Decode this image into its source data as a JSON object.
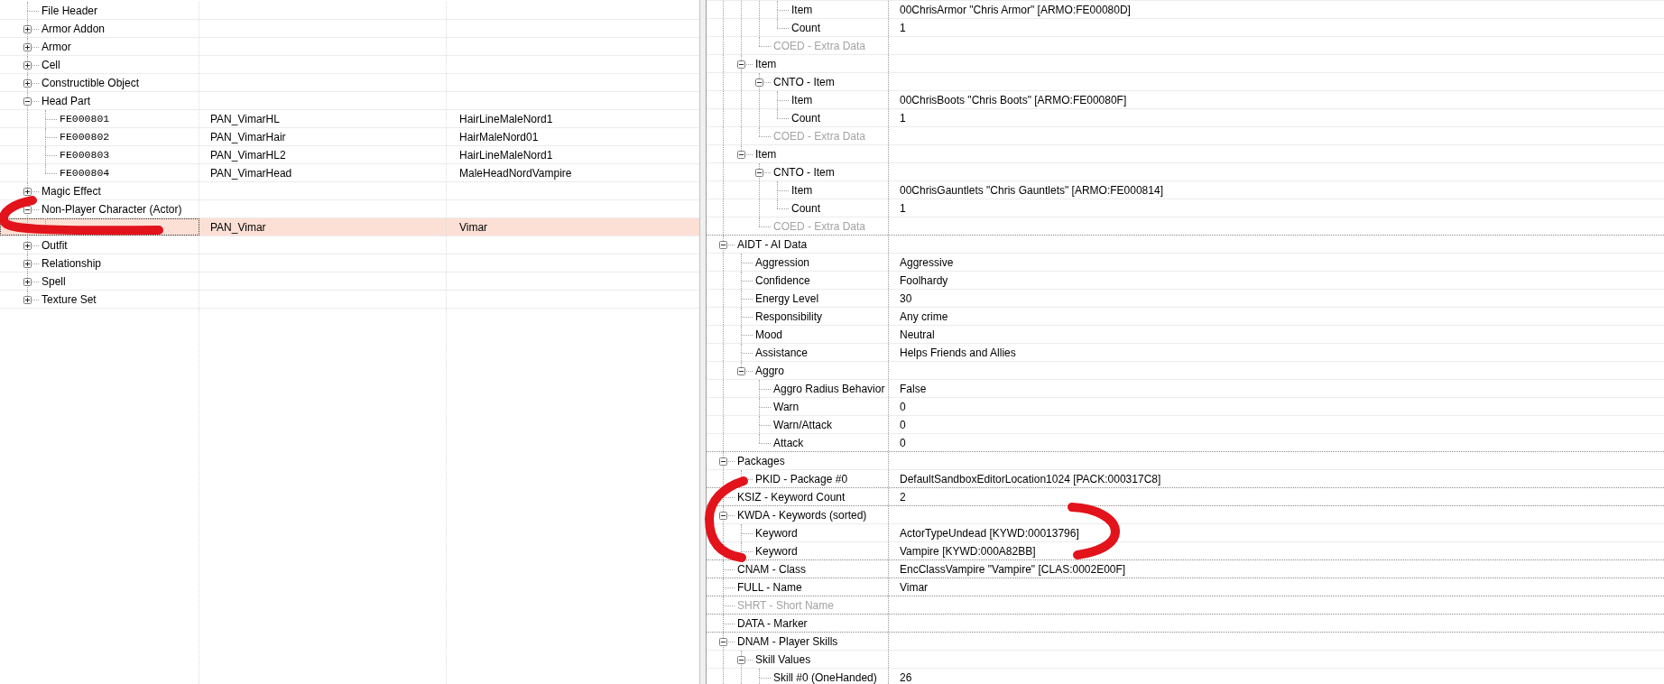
{
  "record_list": {
    "items": [
      {
        "kind": "header",
        "label": "File Header",
        "selected": false
      },
      {
        "kind": "group",
        "label": "Armor Addon",
        "expanded": false,
        "selected": false
      },
      {
        "kind": "group",
        "label": "Armor",
        "expanded": false,
        "selected": false
      },
      {
        "kind": "group",
        "label": "Cell",
        "expanded": false,
        "selected": false
      },
      {
        "kind": "group",
        "label": "Constructible Object",
        "expanded": false,
        "selected": false
      },
      {
        "kind": "group",
        "label": "Head Part",
        "expanded": true,
        "selected": false,
        "children": [
          {
            "kind": "record",
            "form_id": "FE000801",
            "editor_id": "PAN_VimarHL",
            "name": "HairLineMaleNord1",
            "selected": false
          },
          {
            "kind": "record",
            "form_id": "FE000802",
            "editor_id": "PAN_VimarHair",
            "name": "HairMaleNord01",
            "selected": false
          },
          {
            "kind": "record",
            "form_id": "FE000803",
            "editor_id": "PAN_VimarHL2",
            "name": "HairLineMaleNord1",
            "selected": false
          },
          {
            "kind": "record",
            "form_id": "FE000804",
            "editor_id": "PAN_VimarHead",
            "name": "MaleHeadNordVampire",
            "selected": false
          }
        ]
      },
      {
        "kind": "group",
        "label": "Magic Effect",
        "expanded": false,
        "selected": false
      },
      {
        "kind": "group",
        "label": "Non-Player Character (Actor)",
        "expanded": true,
        "selected": false,
        "children": [
          {
            "kind": "record",
            "editor_id": "PAN_Vimar",
            "name": "Vimar",
            "selected": true
          }
        ]
      },
      {
        "kind": "group",
        "label": "Outfit",
        "expanded": false,
        "selected": false
      },
      {
        "kind": "group",
        "label": "Relationship",
        "expanded": false,
        "selected": false
      },
      {
        "kind": "group",
        "label": "Spell",
        "expanded": false,
        "selected": false
      },
      {
        "kind": "group",
        "label": "Texture Set",
        "expanded": false,
        "selected": false
      }
    ]
  },
  "record_view": {
    "fields": [
      {
        "children": [
          {
            "children": [
              {
                "children": [
                  {
                    "label": "Item",
                    "value": "00ChrisArmor \"Chris Armor\" [ARMO:FE00080D]",
                    "disabled": false
                  },
                  {
                    "label": "Count",
                    "value": "1",
                    "disabled": false
                  }
                ]
              },
              {
                "label": "COED - Extra Data",
                "disabled": true
              }
            ]
          },
          {
            "label": "Item",
            "expanded": true,
            "disabled": false,
            "children": [
              {
                "label": "CNTO - Item",
                "expanded": true,
                "disabled": false,
                "children": [
                  {
                    "label": "Item",
                    "value": "00ChrisBoots \"Chris Boots\" [ARMO:FE00080F]",
                    "disabled": false
                  },
                  {
                    "label": "Count",
                    "value": "1",
                    "disabled": false
                  }
                ]
              },
              {
                "label": "COED - Extra Data",
                "disabled": true
              }
            ]
          },
          {
            "label": "Item",
            "expanded": true,
            "disabled": false,
            "children": [
              {
                "label": "CNTO - Item",
                "expanded": true,
                "disabled": false,
                "children": [
                  {
                    "label": "Item",
                    "value": "00ChrisGauntlets \"Chris Gauntlets\" [ARMO:FE000814]",
                    "disabled": false
                  },
                  {
                    "label": "Count",
                    "value": "1",
                    "disabled": false
                  }
                ]
              },
              {
                "label": "COED - Extra Data",
                "disabled": true
              }
            ]
          }
        ]
      },
      {
        "label": "AIDT - AI Data",
        "expanded": true,
        "disabled": false,
        "children": [
          {
            "label": "Aggression",
            "value": "Aggressive",
            "disabled": false
          },
          {
            "label": "Confidence",
            "value": "Foolhardy",
            "disabled": false
          },
          {
            "label": "Energy Level",
            "value": "30",
            "disabled": false
          },
          {
            "label": "Responsibility",
            "value": "Any crime",
            "disabled": false
          },
          {
            "label": "Mood",
            "value": "Neutral",
            "disabled": false
          },
          {
            "label": "Assistance",
            "value": "Helps Friends and Allies",
            "disabled": false
          },
          {
            "label": "Aggro",
            "expanded": true,
            "disabled": false,
            "children": [
              {
                "label": "Aggro Radius Behavior",
                "value": "False",
                "disabled": false
              },
              {
                "label": "Warn",
                "value": "0",
                "disabled": false
              },
              {
                "label": "Warn/Attack",
                "value": "0",
                "disabled": false
              },
              {
                "label": "Attack",
                "value": "0",
                "disabled": false
              }
            ]
          }
        ]
      },
      {
        "label": "Packages",
        "expanded": true,
        "disabled": false,
        "children": [
          {
            "label": "PKID - Package #0",
            "value": "DefaultSandboxEditorLocation1024 [PACK:000317C8]",
            "disabled": false
          }
        ]
      },
      {
        "label": "KSIZ - Keyword Count",
        "value": "2",
        "disabled": false
      },
      {
        "label": "KWDA - Keywords (sorted)",
        "expanded": true,
        "disabled": false,
        "children": [
          {
            "label": "Keyword",
            "value": "ActorTypeUndead [KYWD:00013796]",
            "disabled": false
          },
          {
            "label": "Keyword",
            "value": "Vampire [KYWD:000A82BB]",
            "disabled": false
          }
        ]
      },
      {
        "label": "CNAM - Class",
        "value": "EncClassVampire \"Vampire\" [CLAS:0002E00F]",
        "disabled": false
      },
      {
        "label": "FULL - Name",
        "value": "Vimar",
        "disabled": false
      },
      {
        "label": "SHRT - Short Name",
        "disabled": true
      },
      {
        "label": "DATA - Marker",
        "disabled": false
      },
      {
        "label": "DNAM - Player Skills",
        "expanded": true,
        "disabled": false,
        "children": [
          {
            "label": "Skill Values",
            "expanded": true,
            "disabled": false,
            "children": [
              {
                "label": "Skill #0 (OneHanded)",
                "value": "26",
                "disabled": false
              }
            ]
          }
        ]
      }
    ]
  }
}
